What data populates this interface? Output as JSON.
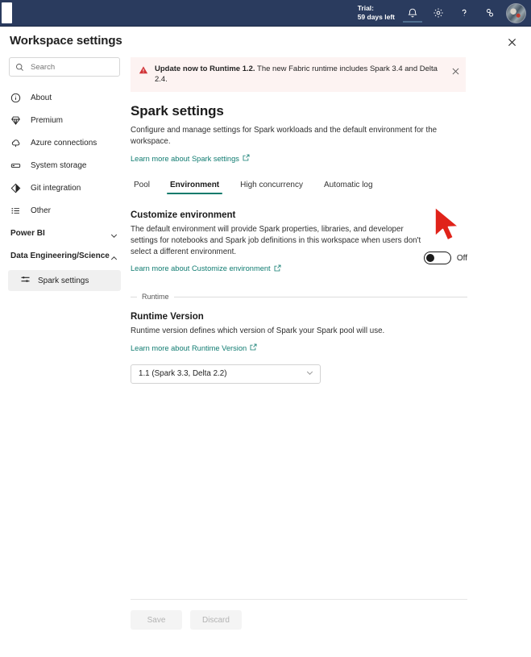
{
  "topbar": {
    "trial_line1": "Trial:",
    "trial_line2": "59 days left",
    "icons": {
      "bell": "bell-icon",
      "settings": "gear-icon",
      "help": "question-mark-icon",
      "feedback": "feedback-icon",
      "avatar": "user-avatar"
    }
  },
  "header": {
    "title": "Workspace settings",
    "close_label": "✕"
  },
  "sidebar": {
    "search": {
      "placeholder": "Search",
      "value": ""
    },
    "items": [
      {
        "label": "About",
        "icon": "info-icon"
      },
      {
        "label": "Premium",
        "icon": "diamond-icon"
      },
      {
        "label": "Azure connections",
        "icon": "cloud-icon"
      },
      {
        "label": "System storage",
        "icon": "storage-icon"
      },
      {
        "label": "Git integration",
        "icon": "git-icon"
      },
      {
        "label": "Other",
        "icon": "list-icon"
      }
    ],
    "groups": [
      {
        "label": "Power BI",
        "expanded": false
      },
      {
        "label": "Data Engineering/Science",
        "expanded": true
      }
    ],
    "sub_items": [
      {
        "label": "Spark settings",
        "icon": "sliders-icon",
        "selected": true
      }
    ]
  },
  "banner": {
    "bold": "Update now to Runtime 1.2.",
    "rest": " The new Fabric runtime includes Spark 3.4 and Delta 2.4.",
    "close": "✕",
    "icon": "warning-triangle-icon",
    "bg_color": "#fdf3f2",
    "icon_color": "#d13438"
  },
  "main": {
    "title": "Spark settings",
    "description": "Configure and manage settings for Spark workloads and the default environment for the workspace.",
    "learn_more": "Learn more about Spark settings",
    "tabs": [
      {
        "label": "Pool",
        "active": false
      },
      {
        "label": "Environment",
        "active": true
      },
      {
        "label": "High concurrency",
        "active": false
      },
      {
        "label": "Automatic log",
        "active": false
      }
    ],
    "accent_color": "#0f7b6c",
    "customize": {
      "title": "Customize environment",
      "description": "The default environment will provide Spark properties, libraries, and developer settings for notebooks and Spark job definitions in this workspace when users don't select a different environment.",
      "learn_more": "Learn more about Customize environment",
      "toggle_state": "Off"
    },
    "runtime_legend": "Runtime",
    "runtime": {
      "title": "Runtime Version",
      "description": "Runtime version defines which version of Spark your Spark pool will use.",
      "learn_more": "Learn more about Runtime Version",
      "selected": "1.1 (Spark 3.3, Delta 2.2)"
    },
    "footer": {
      "save": "Save",
      "discard": "Discard"
    }
  }
}
